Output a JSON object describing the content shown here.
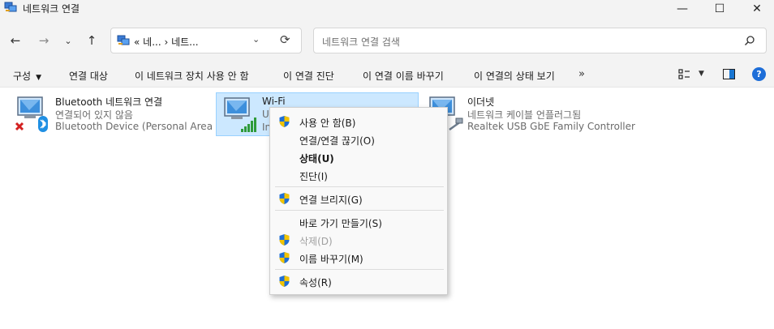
{
  "window": {
    "title": "네트워크 연결",
    "minimize_glyph": "—",
    "maximize_glyph": "☐",
    "close_glyph": "✕"
  },
  "address": {
    "path": "«  네...  ›  네트...",
    "refresh_glyph": "⟳",
    "chevron_glyph": "⌄"
  },
  "search": {
    "placeholder": "네트워크 연결 검색"
  },
  "commands": {
    "organize": "구성",
    "connect_to": "연결 대상",
    "disable": "이 네트워크 장치 사용 안 함",
    "diagnose": "이 연결 진단",
    "rename": "이 연결 이름 바꾸기",
    "status": "이 연결의 상태 보기",
    "more": "»",
    "help": "?"
  },
  "connections": [
    {
      "name": "Bluetooth 네트워크 연결",
      "status": "연결되어 있지 않음",
      "device": "Bluetooth Device (Personal Area ..."
    },
    {
      "name": "Wi-Fi",
      "status": "U",
      "device": "In"
    },
    {
      "name": "이더넷",
      "status": "네트워크 케이블 언플러그됨",
      "device": "Realtek USB GbE Family Controller"
    }
  ],
  "context_menu": {
    "items": [
      {
        "label": "사용 안 함(B)",
        "shield": true
      },
      {
        "label": "연결/연결 끊기(O)",
        "shield": false
      },
      {
        "label": "상태(U)",
        "shield": false,
        "bold": true
      },
      {
        "label": "진단(I)",
        "shield": false
      },
      {
        "label": "연결 브리지(G)",
        "shield": true
      },
      {
        "label": "바로 가기 만들기(S)",
        "shield": false
      },
      {
        "label": "삭제(D)",
        "shield": true,
        "disabled": true
      },
      {
        "label": "이름 바꾸기(M)",
        "shield": true
      },
      {
        "label": "속성(R)",
        "shield": true
      }
    ]
  },
  "colors": {
    "selection_bg": "#cce8ff",
    "selection_border": "#99d1ff",
    "accent": "#1e6ed8"
  }
}
